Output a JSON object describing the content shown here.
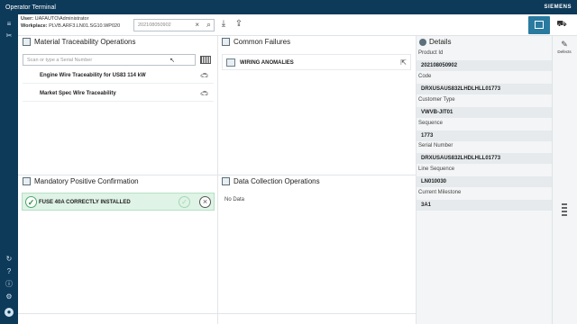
{
  "window": {
    "title": "Operator Terminal",
    "brand": "SIEMENS"
  },
  "user": {
    "user_label": "User:",
    "user_value": "UAFAUTO\\Administrator",
    "workplace_label": "Workplace:",
    "workplace_value": "PLVB.ARF3.LN01.SG10.WP020"
  },
  "serial_search": {
    "value": "202108050902"
  },
  "material": {
    "title": "Material Traceability Operations",
    "search_placeholder": "Scan or type a Serial Number",
    "items": [
      {
        "label": "Engine Wire Traceability for US83 114 kW"
      },
      {
        "label": "Market Spec Wire Traceability"
      }
    ]
  },
  "common_failures": {
    "title": "Common Failures",
    "items": [
      {
        "label": "WIRING ANOMALIES"
      }
    ]
  },
  "mandatory": {
    "title": "Mandatory Positive Confirmation",
    "items": [
      {
        "label": "FUSE 40A CORRECTLY INSTALLED"
      }
    ]
  },
  "data_collection": {
    "title": "Data Collection Operations",
    "empty_text": "No Data"
  },
  "details": {
    "title": "Details",
    "fields": [
      {
        "label": "Product Id",
        "value": "202108050902"
      },
      {
        "label": "Code",
        "value": "DRXUSAUS832LHDLHLL01773"
      },
      {
        "label": "Customer Type",
        "value": "VWVB-JIT01"
      },
      {
        "label": "Sequence",
        "value": "1773"
      },
      {
        "label": "Serial Number",
        "value": "DRXUSAUS832LHDLHLL01773"
      },
      {
        "label": "Line Sequence",
        "value": "LN010030"
      },
      {
        "label": "Current Milestone",
        "value": "3A1"
      }
    ]
  },
  "right_rail": {
    "defects_label": "Defects"
  },
  "colors": {
    "titlebar": "#0e3a5a",
    "accent": "#2a7aa0",
    "confirm_bg": "#dff3e6"
  },
  "icons": [
    "menu-icon",
    "tools-icon",
    "barcode-icon",
    "clear-icon",
    "search-icon",
    "download-icon",
    "share-icon",
    "terminal-icon",
    "truck-icon",
    "car-icon",
    "external-link-icon",
    "check-circle-icon",
    "close-circle-icon",
    "refresh-icon",
    "help-icon",
    "info-icon",
    "settings-icon",
    "avatar-icon"
  ]
}
